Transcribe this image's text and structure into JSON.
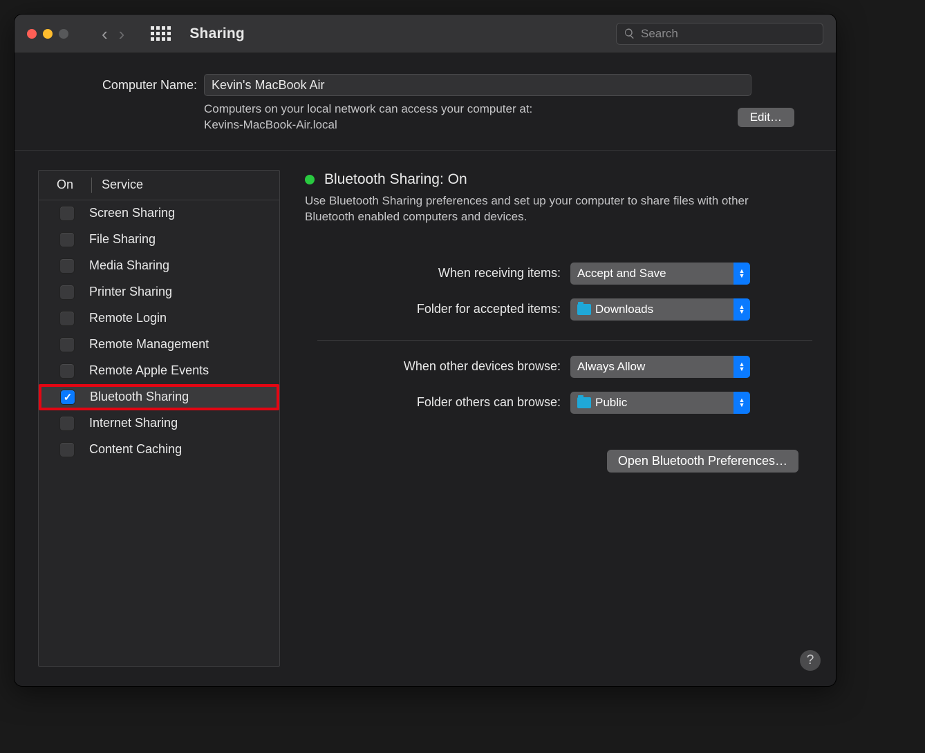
{
  "window": {
    "title": "Sharing",
    "search_placeholder": "Search"
  },
  "computer_name": {
    "label": "Computer Name:",
    "value": "Kevin's MacBook Air",
    "subtext_line1": "Computers on your local network can access your computer at:",
    "subtext_line2": "Kevins-MacBook-Air.local",
    "edit_label": "Edit…"
  },
  "service_table": {
    "header_on": "On",
    "header_service": "Service",
    "rows": [
      {
        "on": false,
        "label": "Screen Sharing"
      },
      {
        "on": false,
        "label": "File Sharing"
      },
      {
        "on": false,
        "label": "Media Sharing"
      },
      {
        "on": false,
        "label": "Printer Sharing"
      },
      {
        "on": false,
        "label": "Remote Login"
      },
      {
        "on": false,
        "label": "Remote Management"
      },
      {
        "on": false,
        "label": "Remote Apple Events"
      },
      {
        "on": true,
        "label": "Bluetooth Sharing"
      },
      {
        "on": false,
        "label": "Internet Sharing"
      },
      {
        "on": false,
        "label": "Content Caching"
      }
    ],
    "selected_index": 7
  },
  "detail": {
    "status_title": "Bluetooth Sharing: On",
    "description": "Use Bluetooth Sharing preferences and set up your computer to share files with other Bluetooth enabled computers and devices.",
    "receiving_label": "When receiving items:",
    "receiving_value": "Accept and Save",
    "accepted_folder_label": "Folder for accepted items:",
    "accepted_folder_value": "Downloads",
    "browse_label": "When other devices browse:",
    "browse_value": "Always Allow",
    "browse_folder_label": "Folder others can browse:",
    "browse_folder_value": "Public",
    "open_btn": "Open Bluetooth Preferences…"
  },
  "help_label": "?"
}
